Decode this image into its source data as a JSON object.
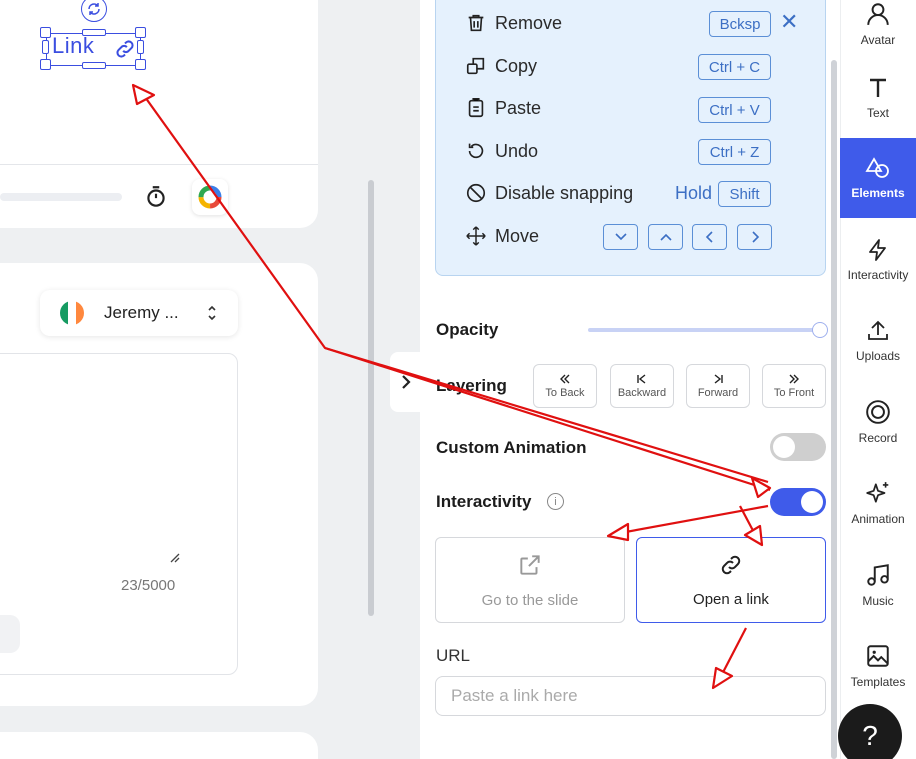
{
  "canvas": {
    "element_text": "Link"
  },
  "editor": {
    "voice_name": "Jeremy ...",
    "char_count": "23/5000"
  },
  "shortcuts": {
    "remove": {
      "label": "Remove",
      "key": "Bcksp"
    },
    "copy": {
      "label": "Copy",
      "key": "Ctrl + C"
    },
    "paste": {
      "label": "Paste",
      "key": "Ctrl + V"
    },
    "undo": {
      "label": "Undo",
      "key": "Ctrl + Z"
    },
    "snapping": {
      "label": "Disable snapping",
      "hold": "Hold",
      "key": "Shift"
    },
    "move": {
      "label": "Move"
    }
  },
  "properties": {
    "opacity_label": "Opacity",
    "opacity_value": 1.0,
    "layering_label": "Layering",
    "layering_buttons": [
      "To Back",
      "Backward",
      "Forward",
      "To Front"
    ],
    "custom_animation_label": "Custom Animation",
    "custom_animation_on": false,
    "interactivity_label": "Interactivity",
    "interactivity_on": true,
    "info_glyph": "i",
    "option_slide": "Go to the slide",
    "option_link": "Open a link",
    "url_label": "URL",
    "url_placeholder": "Paste a link here"
  },
  "sidebar": {
    "items": [
      "Avatar",
      "Text",
      "Elements",
      "Interactivity",
      "Uploads",
      "Record",
      "Animation",
      "Music",
      "Templates"
    ],
    "active": "Elements",
    "help_label": "?"
  },
  "colors": {
    "accent": "#3f5bea",
    "shortcut_bg": "#e5f1fd",
    "annotation": "#e01010",
    "toggle_off": "#cfcfcf"
  }
}
